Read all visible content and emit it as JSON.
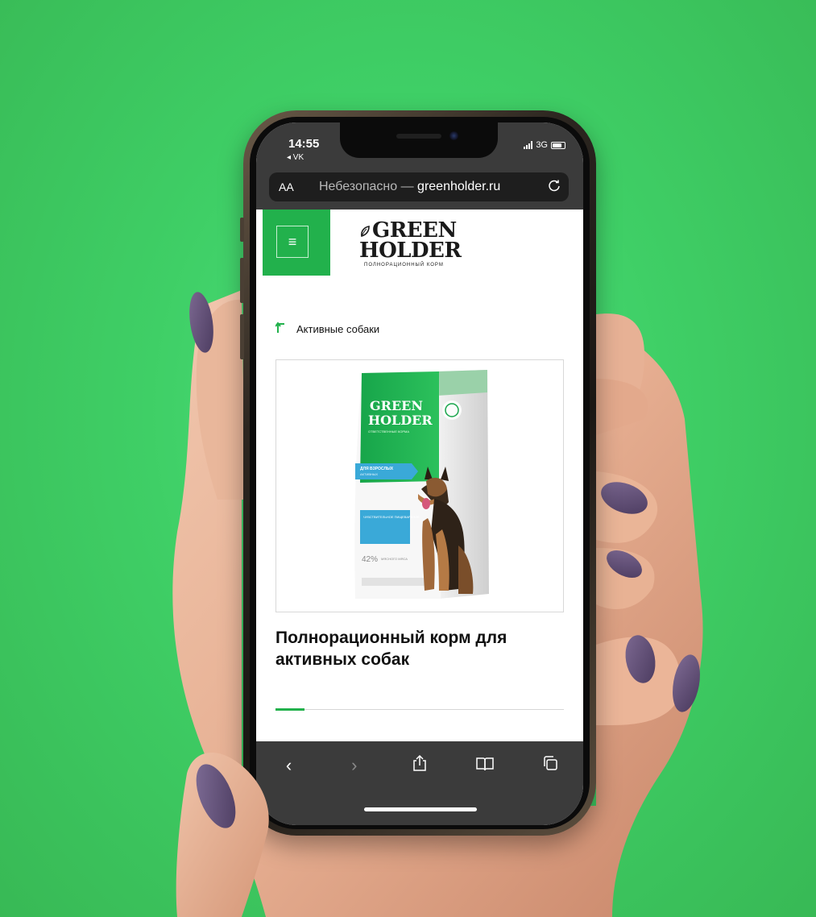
{
  "status": {
    "time": "14:55",
    "back_app": "◂ VK",
    "network": "3G"
  },
  "browser": {
    "aa": "AA",
    "url_prefix": "Небезопасно — ",
    "url_domain": "greenholder.ru",
    "reload_icon": "reload-icon"
  },
  "site": {
    "logo_line1": "GREEN",
    "logo_line2": "HOLDER",
    "logo_tagline": "ПОЛНОРАЦИОННЫЙ КОРМ",
    "menu_icon": "≡",
    "back_arrow": "↑",
    "breadcrumb": "Активные собаки",
    "product_title": "Полнорационный корм для активных собак",
    "slider_progress": 0.1,
    "accent_color": "#22b14c"
  },
  "package": {
    "brand_line1": "GREEN",
    "brand_line2": "HOLDER",
    "tagline": "ОТВЕТСТВЕННЫЕ КОРМА",
    "tag1": "ДЛЯ ВЗРОСЛЫХ",
    "tag1b": "АКТИВНЫХ",
    "tag2": "ЧУВСТВИТЕЛЬНОЕ ПИЩЕВАРЕНИЕ",
    "percent": "42%",
    "percent_label": "МЯСНОГО МЯСА"
  },
  "toolbar": {
    "back": "‹",
    "forward": "›",
    "share": "share-icon",
    "bookmarks": "book-icon",
    "tabs": "tabs-icon"
  }
}
